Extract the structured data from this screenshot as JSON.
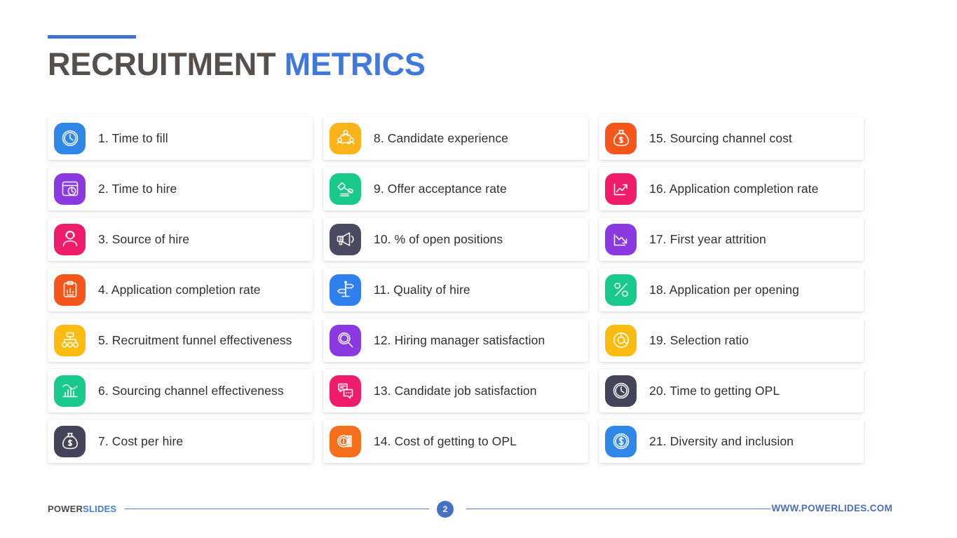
{
  "header": {
    "title_primary": "RECRUITMENT",
    "title_accent": "METRICS",
    "accent_color": "#4074c4",
    "primary_color": "#55504c",
    "accent_text_color": "#3f7ada"
  },
  "metrics": {
    "columns": [
      {
        "items": [
          {
            "label": "1. Time to fill",
            "icon": "clock-icon",
            "color": "#2f88e8"
          },
          {
            "label": "2. Time to hire",
            "icon": "browser-stopwatch-icon",
            "color": "#8a3ae0"
          },
          {
            "label": "3. Source of hire",
            "icon": "person-headset-icon",
            "color": "#ef1c6c"
          },
          {
            "label": "4. Application completion rate",
            "icon": "clipboard-chart-icon",
            "color": "#f4561b"
          },
          {
            "label": "5. Recruitment funnel effectiveness",
            "icon": "org-chart-icon",
            "color": "#fbbc11"
          },
          {
            "label": "6. Sourcing channel effectiveness",
            "icon": "bar-chart-icon",
            "color": "#19c98b"
          },
          {
            "label": "7. Cost per hire",
            "icon": "money-bag-icon",
            "color": "#434459"
          }
        ]
      },
      {
        "items": [
          {
            "label": "8. Candidate experience",
            "icon": "people-group-icon",
            "color": "#fbb31a"
          },
          {
            "label": "9. Offer acceptance rate",
            "icon": "gavel-icon",
            "color": "#18c98a"
          },
          {
            "label": "10. % of open positions",
            "icon": "megaphone-icon",
            "color": "#4a4b61"
          },
          {
            "label": "11. Quality of hire",
            "icon": "signpost-icon",
            "color": "#2f80ef"
          },
          {
            "label": "12. Hiring manager satisfaction",
            "icon": "magnifier-icon",
            "color": "#8a3ae0"
          },
          {
            "label": "13. Candidate job satisfaction",
            "icon": "chat-bubbles-icon",
            "color": "#ef1c6c"
          },
          {
            "label": "14. Cost of getting to OPL",
            "icon": "coins-icon",
            "color": "#f4701b"
          }
        ]
      },
      {
        "items": [
          {
            "label": "15. Sourcing channel cost",
            "icon": "money-bag-icon",
            "color": "#f4561b"
          },
          {
            "label": "16. Application completion rate",
            "icon": "chart-up-icon",
            "color": "#ef1c6c"
          },
          {
            "label": "17. First year attrition",
            "icon": "chart-down-icon",
            "color": "#8a3ae0"
          },
          {
            "label": "18. Application per opening",
            "icon": "percent-icon",
            "color": "#19c98b"
          },
          {
            "label": "19. Selection ratio",
            "icon": "donut-chart-icon",
            "color": "#fbbc11"
          },
          {
            "label": "20. Time to getting OPL",
            "icon": "clock-icon",
            "color": "#434459"
          },
          {
            "label": "21. Diversity and inclusion",
            "icon": "dollar-circle-icon",
            "color": "#2f88e8"
          }
        ]
      }
    ]
  },
  "footer": {
    "brand_primary": "POWER",
    "brand_accent": "SLIDES",
    "page_number": "2",
    "site_url": "WWW.POWERLIDES.COM",
    "rule_color": "#5b7fc0",
    "badge_color": "#4272c0"
  }
}
